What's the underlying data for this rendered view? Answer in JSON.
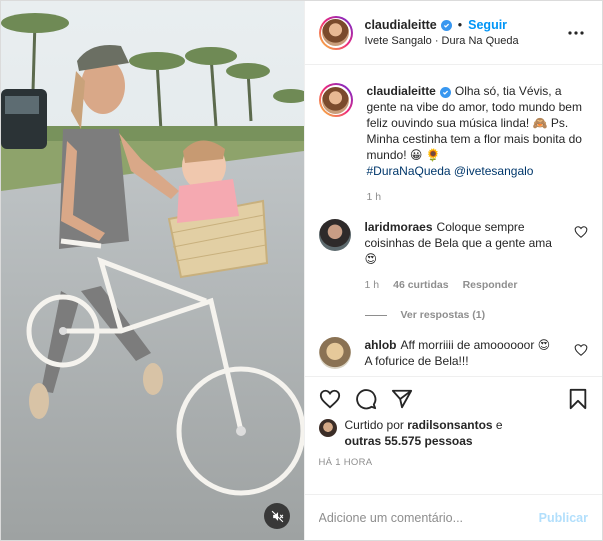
{
  "post": {
    "username": "claudialeitte",
    "follow_label": "Seguir",
    "separator": "•",
    "audio": "Ivete Sangalo · Dura Na Queda"
  },
  "caption": {
    "username": "claudialeitte",
    "text": "Olha só, tia Vévis, a gente na vibe do amor, todo mundo bem feliz ouvindo sua música linda! 🙈 Ps. Minha cestinha tem a flor mais bonita do mundo! 😀 🌻",
    "hashtag": "#DuraNaQueda",
    "mention": "@ivetesangalo",
    "time": "1 h"
  },
  "comments": [
    {
      "username": "laridmoraes",
      "text": "Coloque sempre coisinhas de Bela que a gente ama 😍",
      "time": "1 h",
      "likes": "46 curtidas",
      "reply_label": "Responder",
      "replies_label": "Ver respostas (1)"
    },
    {
      "username": "ahlob",
      "text": "Aff morriiii de amoooooor 😍 A fofurice de Bela!!!"
    }
  ],
  "likes": {
    "prefix": "Curtido por",
    "liker": "radilsonsantos",
    "joiner": "e",
    "others": "outras 55.575 pessoas"
  },
  "timestamp": "HÁ 1 HORA",
  "add_comment": {
    "placeholder": "Adicione um comentário...",
    "publish_label": "Publicar"
  },
  "colors": {
    "accent": "#0095f6",
    "verified": "#3897f0",
    "muted": "#8e8e8e",
    "publish_disabled": "#b2dffc"
  },
  "icons": [
    "mute-icon",
    "more-icon",
    "verified-icon",
    "heart-icon",
    "comment-icon",
    "share-icon",
    "bookmark-icon"
  ]
}
